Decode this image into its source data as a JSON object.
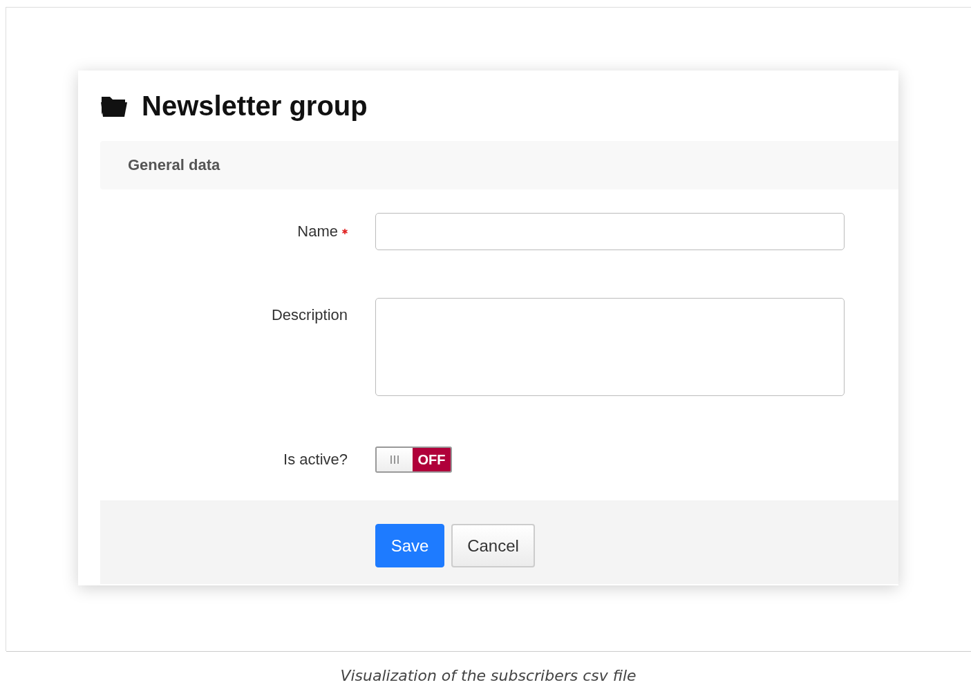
{
  "form": {
    "title": "Newsletter group",
    "section": "General data",
    "fields": [
      {
        "kind": "text",
        "label": "Name",
        "required": true
      },
      {
        "kind": "textarea",
        "label": "Description"
      },
      {
        "kind": "switch",
        "label": "Is active?",
        "on": false,
        "state_label": "OFF"
      }
    ],
    "buttons": [
      {
        "kind": "primary",
        "label": "Save"
      },
      {
        "kind": "default",
        "label": "Cancel"
      }
    ]
  },
  "caption": "Visualization of the subscribers csv file"
}
